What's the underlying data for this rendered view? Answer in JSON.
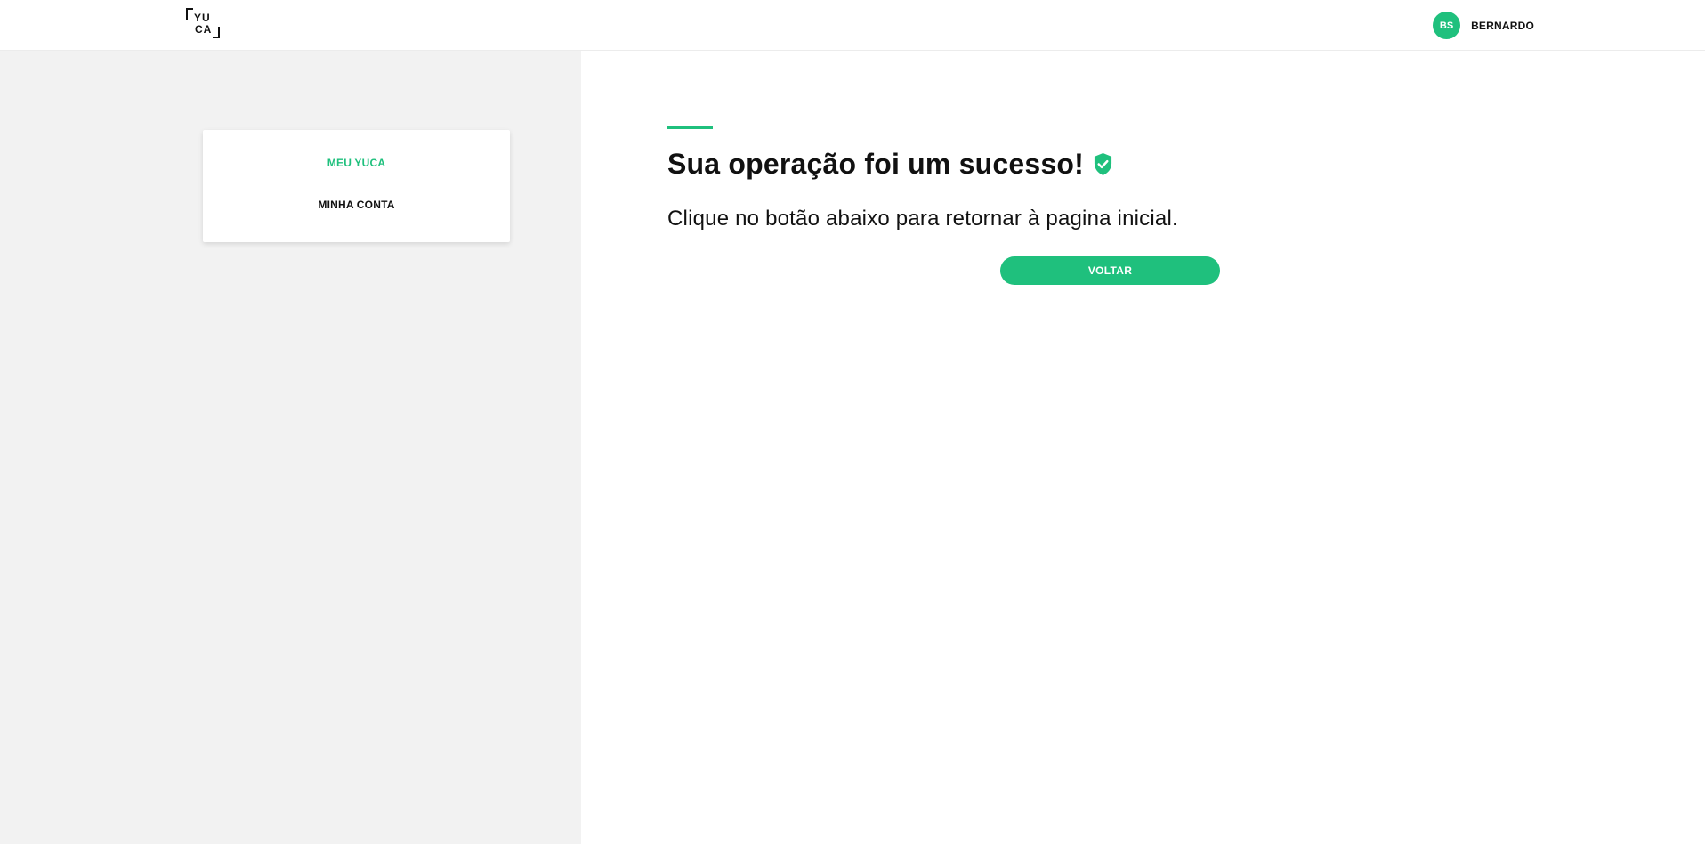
{
  "header": {
    "logo": {
      "row1": "YU",
      "row2": "CA"
    },
    "user": {
      "initials": "BS",
      "name": "BERNARDO"
    }
  },
  "sidebar": {
    "items": [
      {
        "label": "MEU YUCA",
        "active": true
      },
      {
        "label": "MINHA CONTA",
        "active": false
      }
    ]
  },
  "main": {
    "title": "Sua operação foi um sucesso!",
    "subtitle": "Clique no botão abaixo para retornar à pagina inicial.",
    "button_label": "VOLTAR"
  },
  "colors": {
    "accent": "#1fc07d",
    "sidebar_bg": "#f2f2f2",
    "text": "#111111"
  },
  "icons": {
    "title_icon": "shield-check-icon"
  }
}
